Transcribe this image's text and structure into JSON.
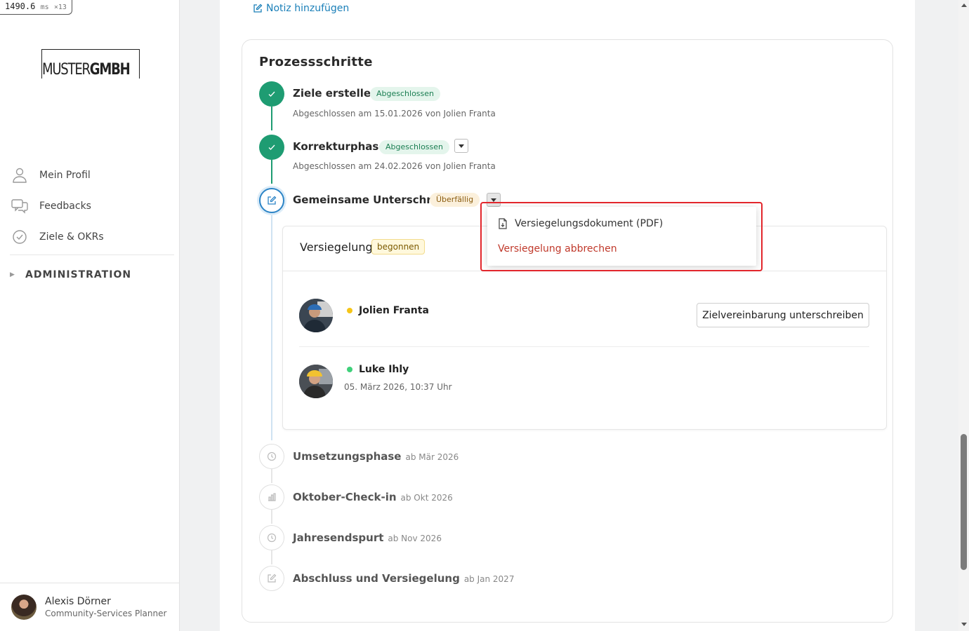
{
  "perf": {
    "value": "1490.6",
    "unit": "ms",
    "mult": "×13"
  },
  "logo": {
    "part1": "MUSTER",
    "part2": "GMBH"
  },
  "nav": {
    "items": [
      {
        "label": "Mein Profil",
        "icon": "person-icon"
      },
      {
        "label": "Feedbacks",
        "icon": "chat-icon"
      },
      {
        "label": "Ziele & OKRs",
        "icon": "check-circle-icon"
      }
    ],
    "admin_label": "ADMINISTRATION"
  },
  "user": {
    "name": "Alexis Dörner",
    "role": "Community-Services Planner"
  },
  "main": {
    "add_note": "Notiz hinzufügen",
    "card_title": "Prozessschritte",
    "steps": [
      {
        "title": "Ziele erstellen",
        "badge": "Abgeschlossen",
        "sub": "Abgeschlossen am 15.01.2026 von Jolien Franta"
      },
      {
        "title": "Korrekturphase",
        "badge": "Abgeschlossen",
        "sub": "Abgeschlossen am 24.02.2026 von Jolien Franta"
      },
      {
        "title": "Gemeinsame Unterschrift",
        "badge": "Überfällig"
      },
      {
        "title": "Umsetzungsphase",
        "when": "ab Mär 2026"
      },
      {
        "title": "Oktober-Check-in",
        "when": "ab Okt 2026"
      },
      {
        "title": "Jahresendspurt",
        "when": "ab Nov 2026"
      },
      {
        "title": "Abschluss und Versiegelung",
        "when": "ab Jan 2027"
      }
    ],
    "seal": {
      "title": "Versiegelung",
      "badge": "begonnen",
      "people": [
        {
          "name": "Jolien Franta",
          "status_color": "#f5c518"
        },
        {
          "name": "Luke Ihly",
          "status_color": "#3fd17a",
          "date": "05. März 2026, 10:37 Uhr"
        }
      ],
      "sign_button": "Zielvereinbarung unterschreiben"
    },
    "dropdown": {
      "items": [
        {
          "label": "Versiegelungsdokument (PDF)",
          "icon": "pdf-file-icon"
        },
        {
          "label": "Versiegelung abbrechen"
        }
      ]
    }
  }
}
